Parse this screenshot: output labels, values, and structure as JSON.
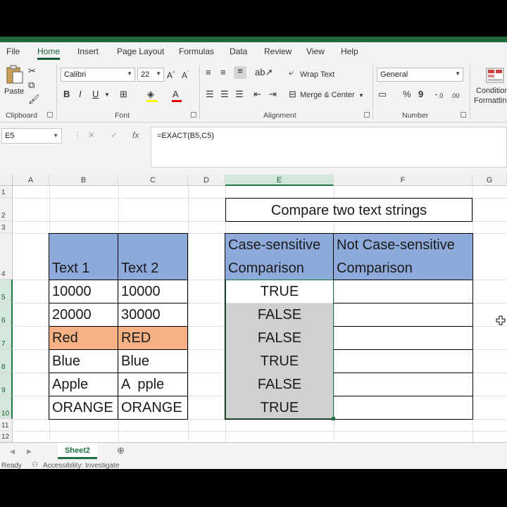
{
  "menu": {
    "tabs": [
      "File",
      "Home",
      "Insert",
      "Page Layout",
      "Formulas",
      "Data",
      "Review",
      "View",
      "Help"
    ],
    "active_tab": "Home"
  },
  "ribbon": {
    "clipboard": {
      "paste_label": "Paste",
      "group_label": "Clipboard"
    },
    "font": {
      "font_name": "Calibri",
      "font_size": "22",
      "group_label": "Font"
    },
    "alignment": {
      "wrap_text": "Wrap Text",
      "merge_center": "Merge & Center",
      "group_label": "Alignment"
    },
    "number": {
      "format": "General",
      "group_label": "Number"
    },
    "styles": {
      "conditional_line1": "Condition",
      "conditional_line2": "Formattin"
    }
  },
  "formula_bar": {
    "name_box": "E5",
    "formula": "=EXACT(B5,C5)"
  },
  "grid": {
    "columns": [
      "A",
      "B",
      "C",
      "D",
      "E",
      "F",
      "G"
    ],
    "selected_column": "E",
    "rows": [
      "1",
      "2",
      "3",
      "4",
      "5",
      "6",
      "7",
      "8",
      "9",
      "10",
      "11",
      "12"
    ],
    "title": "Compare two text strings",
    "headers": {
      "text1": "Text 1",
      "text2": "Text 2",
      "case_sensitive_line1": "Case-sensitive",
      "case_sensitive_line2": "Comparison",
      "not_case_line1": "Not Case-sensitive",
      "not_case_line2": "Comparison"
    },
    "data_rows": [
      {
        "b": "10000",
        "c": "10000",
        "e": "TRUE",
        "f": ""
      },
      {
        "b": "20000",
        "c": "30000",
        "e": "FALSE",
        "f": ""
      },
      {
        "b": "Red",
        "c": "RED",
        "e": "FALSE",
        "f": ""
      },
      {
        "b": "Blue",
        "c": "Blue",
        "e": "TRUE",
        "f": ""
      },
      {
        "b": "Apple",
        "c": "A  pple",
        "e": "FALSE",
        "f": ""
      },
      {
        "b": "ORANGE",
        "c": "ORANGE",
        "e": "TRUE",
        "f": ""
      }
    ]
  },
  "sheets": {
    "active": "Sheet2"
  },
  "status": {
    "ready": "Ready",
    "accessibility": "Accessibility: Investigate"
  },
  "colors": {
    "header_blue": "#8eaadb",
    "red_highlight": "#f4b183",
    "excel_green": "#217346"
  }
}
